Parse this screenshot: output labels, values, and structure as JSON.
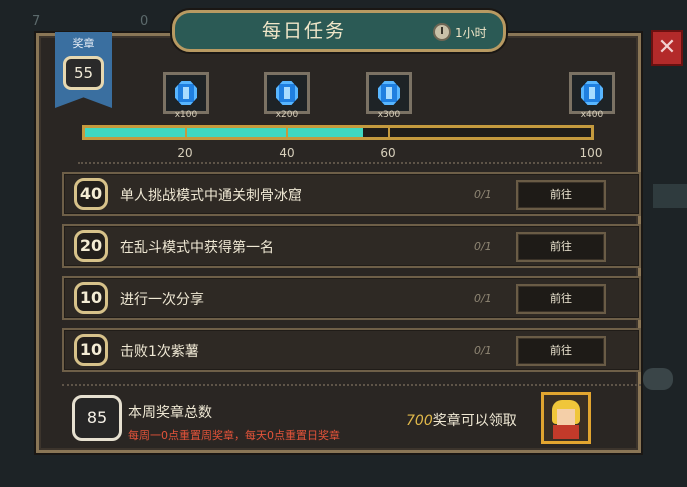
{
  "background_hud": {
    "left_stat": "7",
    "count_a": "0"
  },
  "title": "每日任务",
  "timer": {
    "label": "1小时",
    "icon": "clock-icon"
  },
  "medal": {
    "label": "奖章",
    "count": "55"
  },
  "milestones": [
    {
      "qty": "x100",
      "threshold": "20",
      "icon": "blue-gem-icon"
    },
    {
      "qty": "x200",
      "threshold": "40",
      "icon": "blue-gem-icon"
    },
    {
      "qty": "x300",
      "threshold": "60",
      "icon": "blue-gem-icon"
    },
    {
      "qty": "x400",
      "threshold": "100",
      "icon": "blue-gem-icon"
    }
  ],
  "progress": {
    "current": 55,
    "max": 100
  },
  "tasks": [
    {
      "reward": "40",
      "text": "单人挑战模式中通关刺骨冰窟",
      "progress": "0/1",
      "button": "前往"
    },
    {
      "reward": "20",
      "text": "在乱斗模式中获得第一名",
      "progress": "0/1",
      "button": "前往"
    },
    {
      "reward": "10",
      "text": "进行一次分享",
      "progress": "0/1",
      "button": "前往"
    },
    {
      "reward": "10",
      "text": "击败1次紫薯",
      "progress": "0/1",
      "button": "前往"
    }
  ],
  "weekly": {
    "count": "85",
    "title": "本周奖章总数",
    "note": "每周一0点重置周奖章，每天0点重置日奖章",
    "reward_amount": "700",
    "reward_text": "奖章可以领取",
    "reward_icon": "character-portrait-icon"
  },
  "colors": {
    "panel_bg": "#2a2623",
    "title_tab": "#2b5a55",
    "progress_fill": "#3fd8c0",
    "gold_border": "#c49a3e",
    "warning_text": "#e3533a"
  }
}
